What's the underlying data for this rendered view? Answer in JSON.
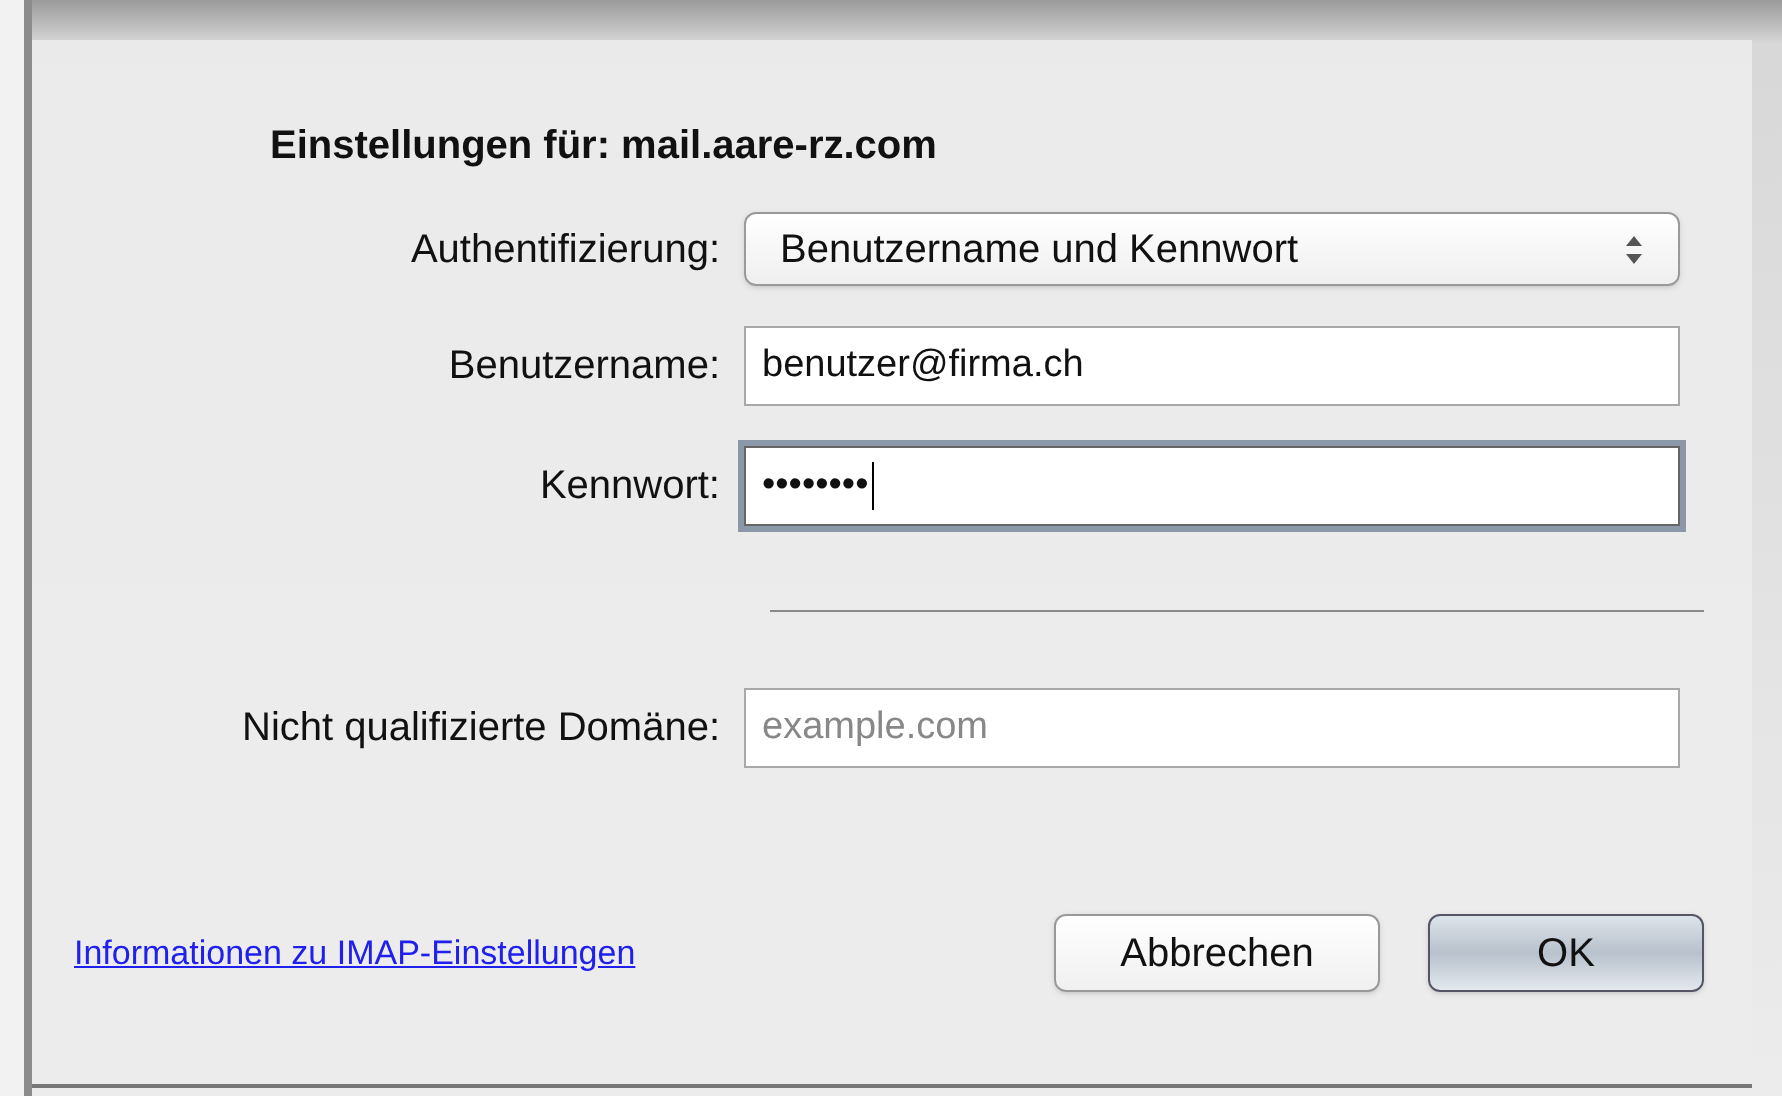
{
  "sheet": {
    "title": "Einstellungen für: mail.aare-rz.com",
    "fields": [
      {
        "kind": "popup",
        "label": "Authentifizierung:",
        "value": "Benutzername und Kennwort",
        "focused": false
      },
      {
        "kind": "text",
        "label": "Benutzername:",
        "value": "benutzer@firma.ch",
        "focused": false
      },
      {
        "kind": "password",
        "label": "Kennwort:",
        "value": "••••••••",
        "focused": true
      }
    ],
    "domain_field": {
      "label": "Nicht qualifizierte Domäne:",
      "placeholder": "example.com",
      "focused": false
    },
    "help_link": "Informationen zu IMAP-Einstellungen",
    "buttons": [
      {
        "label": "Abbrechen",
        "default": false
      },
      {
        "label": "OK",
        "default": true
      }
    ]
  }
}
